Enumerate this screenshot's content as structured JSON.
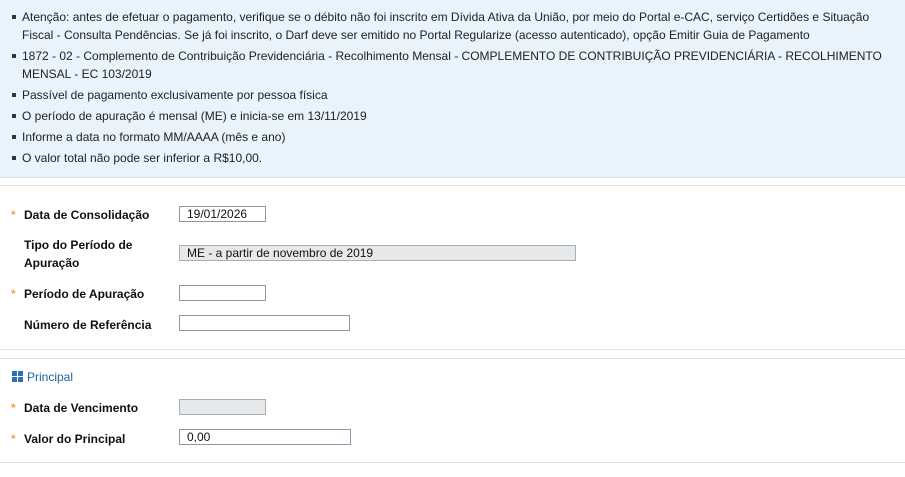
{
  "info": {
    "items": [
      "Atenção: antes de efetuar o pagamento, verifique se o débito não foi inscrito em Dívida Ativa da União, por meio do Portal e-CAC, serviço Certidões e Situação Fiscal - Consulta Pendências. Se já foi inscrito, o Darf deve ser emitido no Portal Regularize (acesso autenticado), opção Emitir Guia de Pagamento",
      "1872 - 02 - Complemento de Contribuição Previdenciária - Recolhimento Mensal - COMPLEMENTO DE CONTRIBUIÇÃO PREVIDENCIÁRIA - RECOLHIMENTO MENSAL - EC 103/2019",
      "Passível de pagamento exclusivamente por pessoa física",
      "O período de apuração é mensal (ME) e inicia-se em 13/11/2019",
      "Informe a data no formato MM/AAAA (mês e ano)",
      "O valor total não pode ser inferior a R$10,00."
    ]
  },
  "form": {
    "required_marker": "*",
    "data_consolidacao": {
      "label": "Data de Consolidação",
      "value": "19/01/2026"
    },
    "tipo_periodo": {
      "label": "Tipo do Período de Apuração",
      "value": "ME - a partir de novembro de 2019"
    },
    "periodo_apuracao": {
      "label": "Período de Apuração",
      "value": ""
    },
    "numero_referencia": {
      "label": "Número de Referência",
      "value": ""
    }
  },
  "principal": {
    "title": "Principal",
    "data_vencimento": {
      "label": "Data de Vencimento",
      "value": ""
    },
    "valor_principal": {
      "label": "Valor do Principal",
      "value": "0,00"
    }
  },
  "colors": {
    "info_background": "#e8f3fb",
    "required_star": "#f0a23c",
    "section_title": "#1f5f9e"
  }
}
